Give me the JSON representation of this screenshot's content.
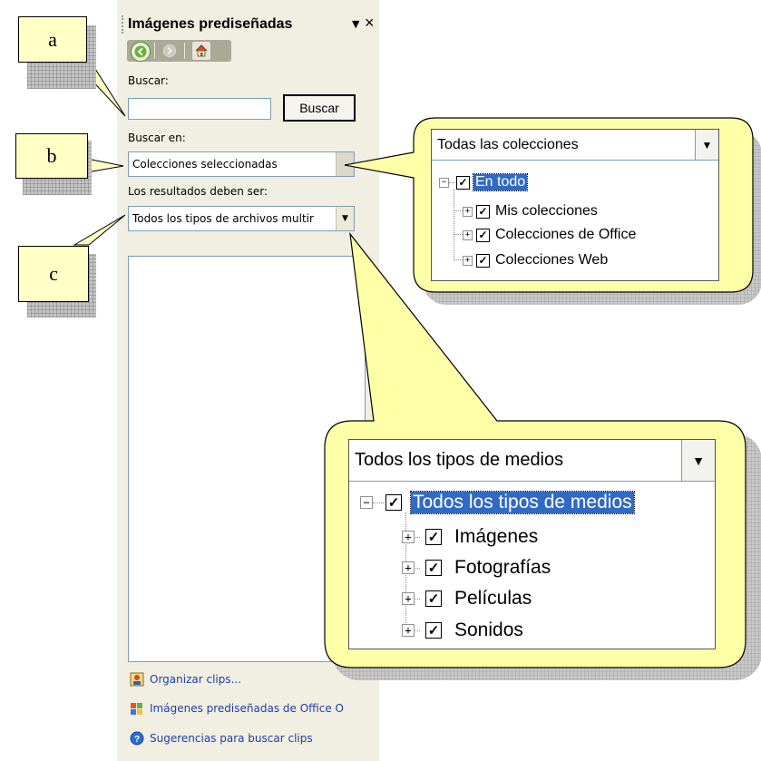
{
  "pane": {
    "title": "Imágenes prediseñadas",
    "menu_icon": "dropdown-arrow-icon",
    "close_icon": "close-icon",
    "close_glyph": "×",
    "menu_glyph": "▼",
    "nav": {
      "back_icon": "back-arrow-icon",
      "forward_icon": "forward-arrow-icon",
      "home_icon": "home-icon"
    },
    "search_label": "Buscar:",
    "search_value": "",
    "search_button": "Buscar",
    "search_in_label": "Buscar en:",
    "search_in_value": "Colecciones seleccionadas",
    "results_label": "Los resultados deben ser:",
    "results_value": "Todos los tipos de archivos multir",
    "links": [
      {
        "label": "Organizar clips...",
        "icon": "organize-clips-icon"
      },
      {
        "label": "Imágenes prediseñadas de Office O",
        "icon": "office-online-icon"
      },
      {
        "label": "Sugerencias para buscar clips",
        "icon": "help-icon"
      }
    ]
  },
  "callouts": {
    "a": "a",
    "b": "b",
    "c": "c"
  },
  "collections_popup": {
    "selected": "Todas las colecciones",
    "items": [
      {
        "label": "En todo",
        "expander": "−",
        "selected": true
      },
      {
        "label": "Mis colecciones",
        "expander": "+"
      },
      {
        "label": "Colecciones de Office",
        "expander": "+"
      },
      {
        "label": "Colecciones Web",
        "expander": "+"
      }
    ]
  },
  "media_popup": {
    "selected": "Todos los tipos de medios",
    "items": [
      {
        "label": "Todos los tipos de medios",
        "expander": "−",
        "selected": true
      },
      {
        "label": "Imágenes",
        "expander": "+"
      },
      {
        "label": "Fotografías",
        "expander": "+"
      },
      {
        "label": "Películas",
        "expander": "+"
      },
      {
        "label": "Sonidos",
        "expander": "+"
      }
    ]
  },
  "colors": {
    "pane_bg": "#f1efe2",
    "callout_fill": "#ffffc6",
    "selection": "#316ac5",
    "link": "#1f3fa8"
  }
}
